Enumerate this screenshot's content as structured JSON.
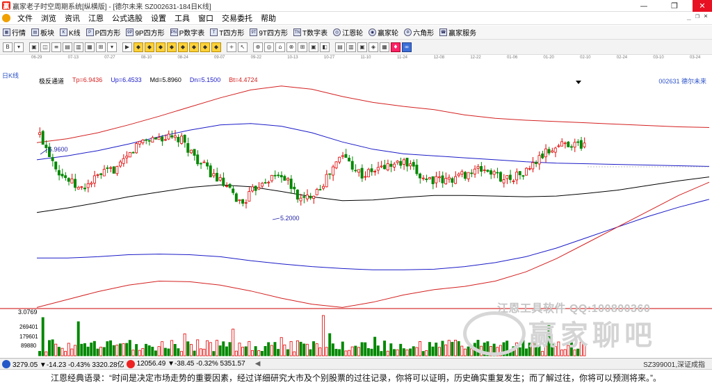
{
  "titlebar": {
    "title": "赢家老子时空周期系统[纵横版] - [德尔未来  SZ002631-184日K线]"
  },
  "window_controls": {
    "minimize": "—",
    "restore": "❐",
    "close": "✕"
  },
  "menu": {
    "items": [
      "文件",
      "浏览",
      "资讯",
      "江恩",
      "公式选股",
      "设置",
      "工具",
      "窗口",
      "交易委托",
      "帮助"
    ],
    "right": [
      "_",
      "❐",
      "×"
    ]
  },
  "toolbar1": {
    "items": [
      {
        "label": "行情",
        "icon": "quote"
      },
      {
        "label": "板块",
        "icon": "sector"
      },
      {
        "label": "K线",
        "icon": "kline"
      },
      {
        "label": "P四方形",
        "icon": "P"
      },
      {
        "label": "9P四方形",
        "icon": "9P"
      },
      {
        "label": "P数字表",
        "icon": "PN"
      },
      {
        "label": "T四方形",
        "icon": "T"
      },
      {
        "label": "9T四方形",
        "icon": "9T"
      },
      {
        "label": "T数字表",
        "icon": "TN"
      },
      {
        "label": "江恩轮",
        "icon": "wheel"
      },
      {
        "label": "赢家轮",
        "icon": "wheel"
      },
      {
        "label": "六角形",
        "icon": "hex"
      },
      {
        "label": "赢家服务",
        "icon": "service"
      }
    ]
  },
  "toolbar2": {
    "tools": [
      "B",
      "▾",
      "▣",
      "◫",
      "≡",
      "▤",
      "▥",
      "▦",
      "⊞",
      "▾",
      "▶",
      "◆",
      "◆",
      "◆",
      "◆",
      "◆",
      "◆",
      "◆",
      "◆",
      "+",
      "↖",
      "⊕",
      "◎",
      "⌂",
      "⊗",
      "⊞",
      "▣",
      "◧",
      "▤",
      "▥",
      "▣",
      "◈",
      "▦",
      "♦",
      "∞"
    ]
  },
  "period": "日K线",
  "dates": [
    "06-29",
    "07-13",
    "07-27",
    "08-10",
    "08-24",
    "09-07",
    "09-22",
    "10-13",
    "10-27",
    "11-10",
    "11-24",
    "12-08",
    "12-22",
    "01-06",
    "01-20",
    "02-10",
    "02-24",
    "03-10",
    "03-24"
  ],
  "indicator": {
    "name": "极反通道",
    "tp": "Tp=6.9436",
    "up": "Up=6.4533",
    "md": "Md=5.8960",
    "dn": "Dn=5.1500",
    "bt": "Bt=4.4724"
  },
  "stock": {
    "code": "002631",
    "name": "德尔未来"
  },
  "annotations": {
    "high": "6.9600",
    "low": "5.2000"
  },
  "volume": {
    "scale_top": "3.0769",
    "ticks": [
      "269401",
      "179601",
      "89880"
    ]
  },
  "statusbar": {
    "sh": "3279.05 ▼-14.23 -0.43% 3320.28亿",
    "sz": "12056.49 ▼-38.45 -0.32% 5351.57",
    "scroll": "◀",
    "right": "SZ399001,深证成指"
  },
  "quote": "江恩经典语录：“时间是决定市场走势的重要因素，经过详细研究大市及个别股票的过往记录，你将可以证明，历史确实重复发生；而了解过往，你将可以预测将来。”。",
  "watermark": {
    "line1": "江恩工具软件  QQ:100800360",
    "line2": "赢家聊吧"
  },
  "colors": {
    "tp": "#d41f1f",
    "up": "#1a1ac8",
    "md": "#000000",
    "candle_up": "#e00000",
    "candle_down": "#008800",
    "period": "#2a50c8"
  },
  "chart_data": {
    "type": "candlestick",
    "title": "",
    "xlabel": "",
    "ylabel": "",
    "series": [
      {
        "name": "Tp",
        "values": [
          6.18,
          6.24,
          6.33,
          6.45,
          6.58,
          6.72,
          6.86,
          6.98,
          7.04,
          6.99,
          6.88,
          6.79,
          6.73,
          6.68,
          6.6,
          6.55,
          6.52,
          6.5,
          6.48,
          6.46,
          6.44,
          6.42,
          6.41
        ]
      },
      {
        "name": "Up",
        "values": [
          5.92,
          5.98,
          6.06,
          6.16,
          6.27,
          6.37,
          6.45,
          6.47,
          6.43,
          6.33,
          6.19,
          6.08,
          6.01,
          5.98,
          5.95,
          5.92,
          5.89,
          5.87,
          5.86,
          5.85,
          5.84,
          5.83,
          5.82
        ]
      },
      {
        "name": "Md",
        "values": [
          5.12,
          5.19,
          5.27,
          5.36,
          5.43,
          5.5,
          5.54,
          5.51,
          5.44,
          5.36,
          5.3,
          5.31,
          5.35,
          5.38,
          5.38,
          5.37,
          5.36,
          5.37,
          5.41,
          5.46,
          5.53,
          5.6,
          5.66
        ]
      },
      {
        "name": "Dn",
        "values": [
          4.43,
          4.43,
          4.45,
          4.48,
          4.49,
          4.48,
          4.45,
          4.39,
          4.34,
          4.3,
          4.27,
          4.25,
          4.25,
          4.26,
          4.3,
          4.36,
          4.45,
          4.58,
          4.74,
          4.9,
          5.06,
          5.2,
          5.32
        ]
      },
      {
        "name": "Bt",
        "values": [
          3.68,
          3.8,
          3.92,
          4.02,
          4.08,
          4.07,
          4.02,
          3.93,
          3.82,
          3.73,
          3.68,
          3.76,
          3.87,
          3.95,
          4.0,
          4.08,
          4.22,
          4.42,
          4.66,
          4.9,
          5.14,
          5.38,
          5.58
        ]
      }
    ],
    "close": [
      6.3,
      5.72,
      5.46,
      5.69,
      5.82,
      6.21,
      6.26,
      6.22,
      5.86,
      5.57,
      5.25,
      5.6,
      5.7,
      5.28,
      5.55,
      6.0,
      5.68,
      5.81,
      5.88,
      5.65,
      5.59,
      5.7,
      5.78,
      5.63,
      5.71,
      6.01,
      6.18,
      6.14
    ],
    "volume_max": 3.0769
  }
}
